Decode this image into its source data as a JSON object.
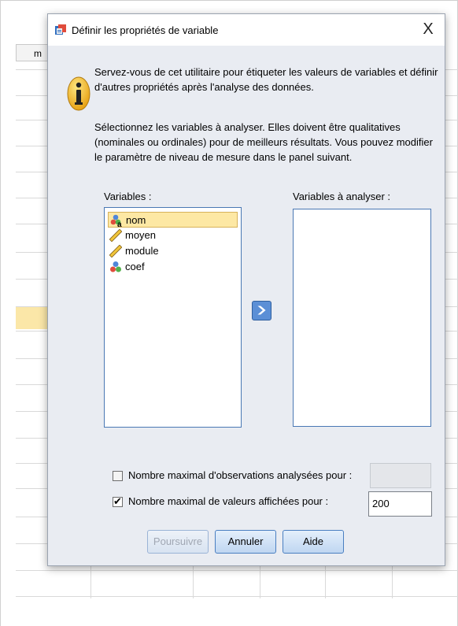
{
  "background": {
    "column_header": "m"
  },
  "dialog": {
    "title": "Définir les propriétés de variable",
    "close_glyph": "X",
    "intro_text": "Servez-vous de cet utilitaire pour étiqueter les valeurs de variables et définir d'autres propriétés après l'analyse des données.",
    "instructions_text": "Sélectionnez les variables à analyser. Elles doivent être qualitatives (nominales ou ordinales) pour de meilleurs résultats. Vous pouvez modifier le paramètre de niveau de mesure dans le panel suivant.",
    "variables_label": "Variables :",
    "variables": [
      {
        "name": "nom",
        "icon": "nominal-string-icon",
        "selected": true
      },
      {
        "name": "moyen",
        "icon": "scale-ruler-icon",
        "selected": false
      },
      {
        "name": "module",
        "icon": "scale-ruler-icon",
        "selected": false
      },
      {
        "name": "coef",
        "icon": "nominal-icon",
        "selected": false
      }
    ],
    "analyze_label": "Variables à analyser :",
    "analyze_variables": [],
    "max_observations": {
      "label": "Nombre maximal d'observations analysées pour :",
      "checked": false,
      "value": ""
    },
    "max_values": {
      "label": "Nombre maximal de valeurs affichées pour :",
      "checked": true,
      "value": "200"
    },
    "buttons": {
      "continue": "Poursuivre",
      "cancel": "Annuler",
      "help": "Aide"
    }
  }
}
